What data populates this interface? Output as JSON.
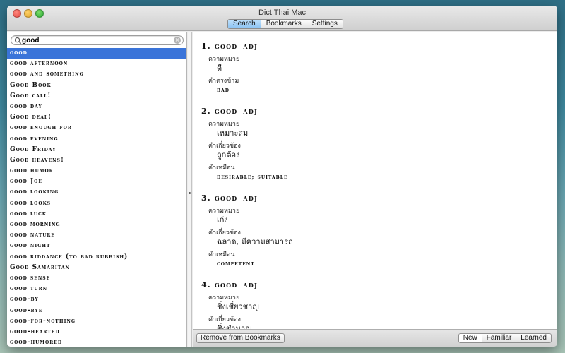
{
  "window": {
    "title": "Dict Thai Mac"
  },
  "toolbar": {
    "tabs": [
      {
        "label": "Search",
        "active": true
      },
      {
        "label": "Bookmarks",
        "active": false
      },
      {
        "label": "Settings",
        "active": false
      }
    ]
  },
  "search": {
    "value": "good",
    "clear_icon": "x-circle-icon"
  },
  "word_list": {
    "selected_index": 0,
    "items": [
      "good",
      "good afternoon",
      "good and something",
      "Good Book",
      "Good call!",
      "good day",
      "Good deal!",
      "good enough for",
      "good evening",
      "Good Friday",
      "Good heavens!",
      "good humor",
      "good Joe",
      "good looking",
      "good looks",
      "good luck",
      "good morning",
      "good nature",
      "good night",
      "good riddance (to bad rubbish)",
      "Good Samaritan",
      "good sense",
      "good turn",
      "good-by",
      "good-bye",
      "good-for-nothing",
      "good-hearted",
      "good-humored"
    ]
  },
  "senses": [
    {
      "heading": "1. good",
      "pos": "adj",
      "fields": [
        {
          "label": "ความหมาย",
          "value": "ดี",
          "latin": false
        },
        {
          "label": "คำตรงข้าม",
          "value": "bad",
          "latin": true
        }
      ]
    },
    {
      "heading": "2. good",
      "pos": "adj",
      "fields": [
        {
          "label": "ความหมาย",
          "value": "เหมาะสม",
          "latin": false
        },
        {
          "label": "คำเกี่ยวข้อง",
          "value": "ถูกต้อง",
          "latin": false
        },
        {
          "label": "คำเหมือน",
          "value": "desirable; suitable",
          "latin": true
        }
      ]
    },
    {
      "heading": "3. good",
      "pos": "adj",
      "fields": [
        {
          "label": "ความหมาย",
          "value": "เก่ง",
          "latin": false
        },
        {
          "label": "คำเกี่ยวข้อง",
          "value": "ฉลาด, มีความสามารถ",
          "latin": false
        },
        {
          "label": "คำเหมือน",
          "value": "competent",
          "latin": true
        }
      ]
    },
    {
      "heading": "4. good",
      "pos": "adj",
      "fields": [
        {
          "label": "ความหมาย",
          "value": "ชิ่งเชี่ยวชาญ",
          "latin": false
        },
        {
          "label": "คำเกี่ยวข้อง",
          "value": "ชิ่งชำนาญ",
          "latin": false
        }
      ]
    }
  ],
  "bottom": {
    "remove_label": "Remove from Bookmarks",
    "filters": [
      {
        "label": "New",
        "active": true
      },
      {
        "label": "Familiar",
        "active": false
      },
      {
        "label": "Learned",
        "active": false
      }
    ]
  },
  "colors": {
    "selection": "#3a74d9",
    "active_tab": "#8bc2f2"
  }
}
